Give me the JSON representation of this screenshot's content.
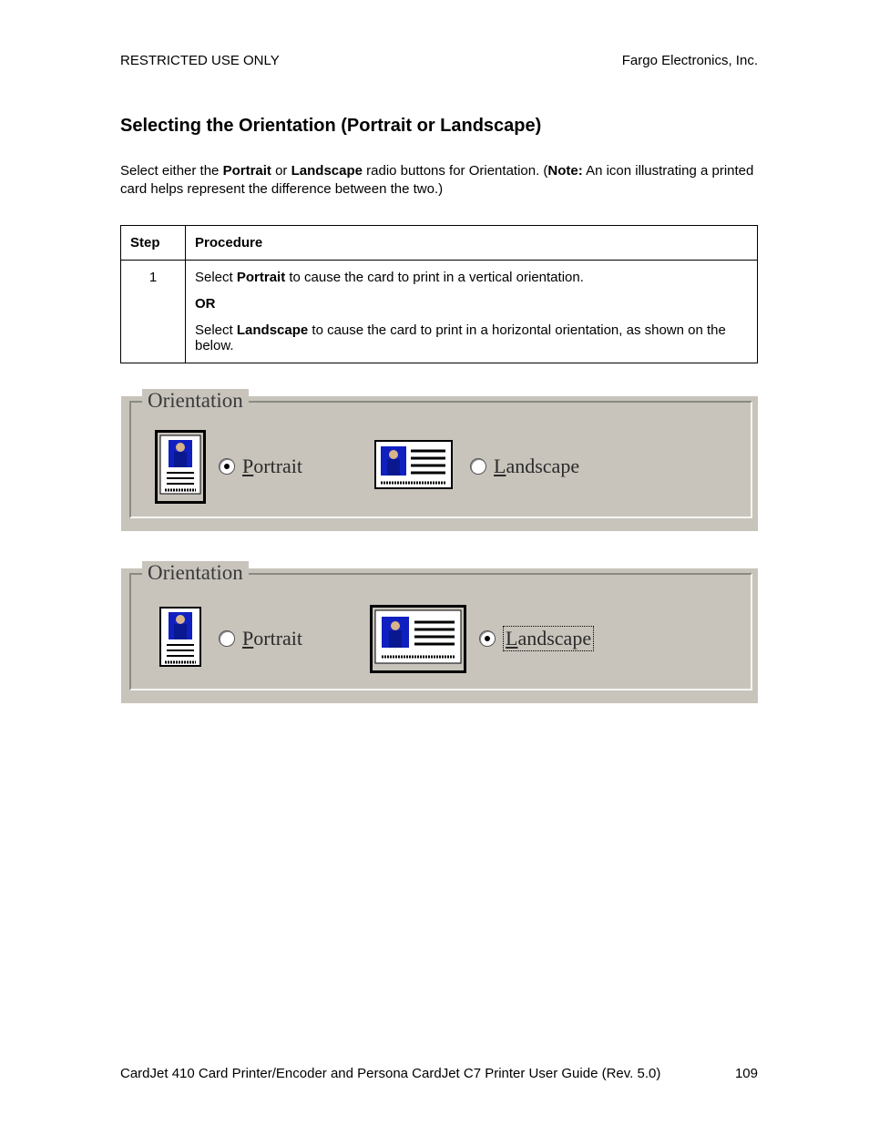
{
  "header": {
    "left": "RESTRICTED USE ONLY",
    "right": "Fargo Electronics, Inc."
  },
  "title": "Selecting the Orientation (Portrait or Landscape)",
  "intro": {
    "pre": "Select either the ",
    "b1": "Portrait",
    "mid1": " or ",
    "b2": "Landscape",
    "mid2": " radio buttons for Orientation. (",
    "b3": "Note:",
    "post": "  An icon illustrating a printed card helps represent the difference between the two.)"
  },
  "table": {
    "h1": "Step",
    "h2": "Procedure",
    "row1": {
      "step": "1",
      "l1a": "Select ",
      "l1b": "Portrait",
      "l1c": " to cause the card to print in a vertical orientation.",
      "or": "OR",
      "l2a": "Select ",
      "l2b": "Landscape",
      "l2c": " to cause the card to print in a horizontal orientation, as shown on the below."
    }
  },
  "panel": {
    "legend": "Orientation",
    "portrait_prefix": "P",
    "portrait_rest": "ortrait",
    "landscape_prefix": "L",
    "landscape_rest": "andscape"
  },
  "footer": {
    "text": "CardJet 410 Card Printer/Encoder and Persona CardJet C7 Printer User Guide (Rev. 5.0)",
    "page": "109"
  }
}
